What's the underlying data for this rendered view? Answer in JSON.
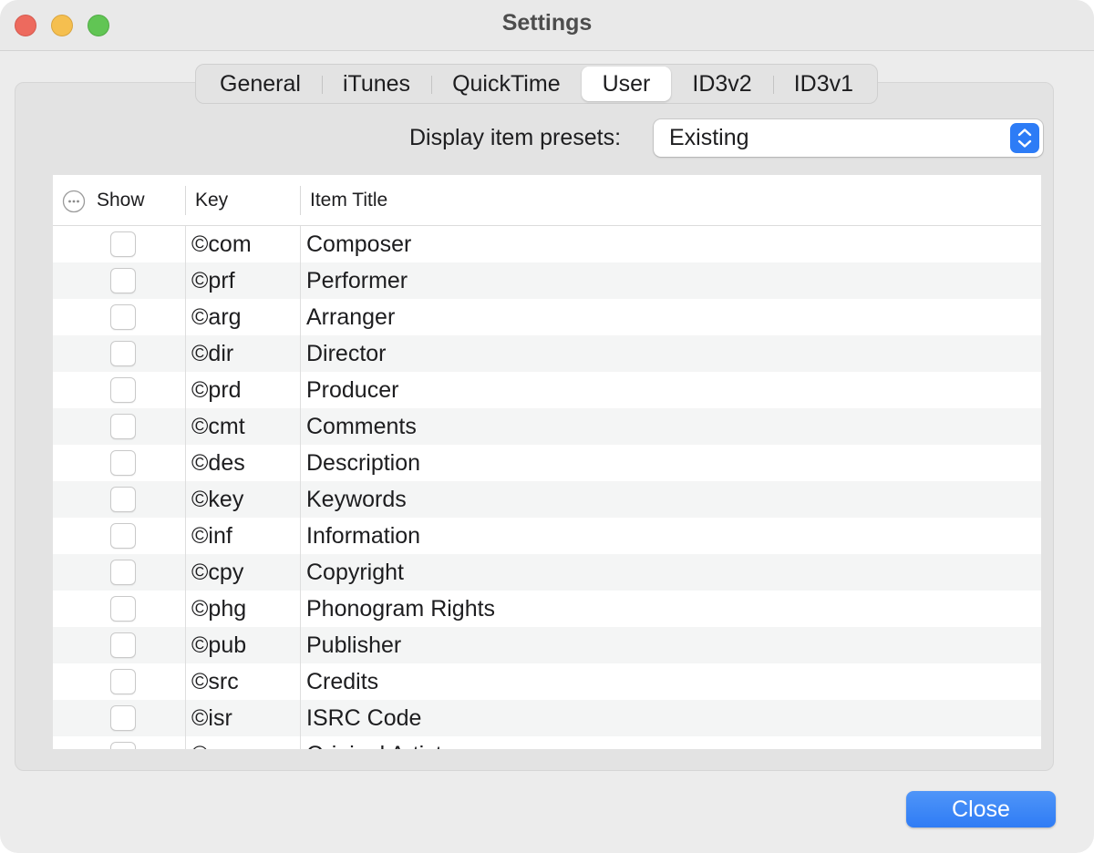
{
  "window": {
    "title": "Settings"
  },
  "tabs": [
    {
      "label": "General"
    },
    {
      "label": "iTunes"
    },
    {
      "label": "QuickTime"
    },
    {
      "label": "User"
    },
    {
      "label": "ID3v2"
    },
    {
      "label": "ID3v1"
    }
  ],
  "active_tab": "User",
  "presets": {
    "label": "Display item presets:",
    "value": "Existing"
  },
  "table": {
    "headers": {
      "show": "Show",
      "key": "Key",
      "title": "Item Title"
    },
    "rows": [
      {
        "key": "©com",
        "title": "Composer",
        "checked": false
      },
      {
        "key": "©prf",
        "title": "Performer",
        "checked": false
      },
      {
        "key": "©arg",
        "title": "Arranger",
        "checked": false
      },
      {
        "key": "©dir",
        "title": "Director",
        "checked": false
      },
      {
        "key": "©prd",
        "title": "Producer",
        "checked": false
      },
      {
        "key": "©cmt",
        "title": "Comments",
        "checked": false
      },
      {
        "key": "©des",
        "title": "Description",
        "checked": false
      },
      {
        "key": "©key",
        "title": "Keywords",
        "checked": false
      },
      {
        "key": "©inf",
        "title": "Information",
        "checked": false
      },
      {
        "key": "©cpy",
        "title": "Copyright",
        "checked": false
      },
      {
        "key": "©phg",
        "title": "Phonogram Rights",
        "checked": false
      },
      {
        "key": "©pub",
        "title": "Publisher",
        "checked": false
      },
      {
        "key": "©src",
        "title": "Credits",
        "checked": false
      },
      {
        "key": "©isr",
        "title": "ISRC Code",
        "checked": false
      },
      {
        "key": "©ope",
        "title": "Original Artist",
        "checked": false
      }
    ]
  },
  "buttons": {
    "close": "Close"
  },
  "colors": {
    "accent": "#2f7cf5",
    "traffic_close": "#ed6a5e",
    "traffic_minimize": "#f5bf4f",
    "traffic_maximize": "#61c554"
  }
}
